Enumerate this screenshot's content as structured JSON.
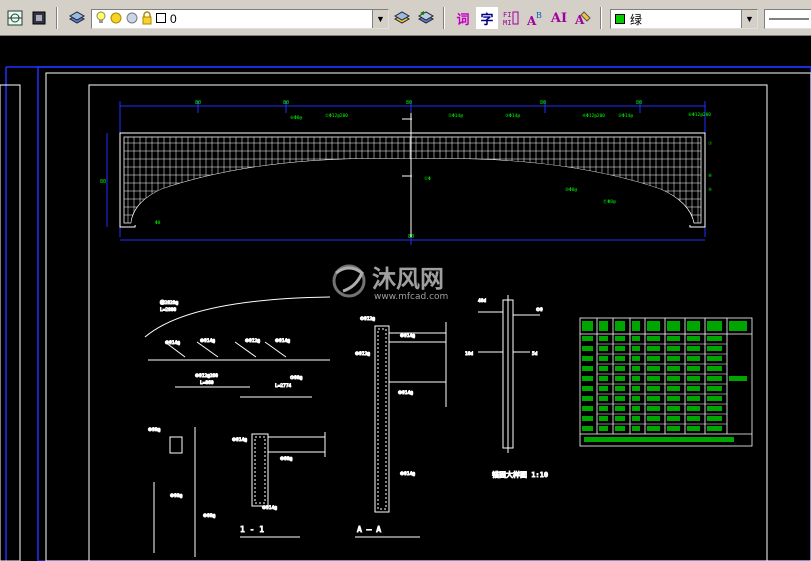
{
  "toolbar": {
    "layer_combo": {
      "value": "0"
    },
    "color_combo": {
      "value": "绿",
      "swatch": "#00cc00"
    },
    "text_buttons": [
      "词",
      "字",
      "AI"
    ],
    "icons": [
      "layer-manager-icon",
      "layer-states-icon",
      "lightbulb-icon",
      "sun-icon",
      "freeze-icon",
      "lock-icon",
      "color-square-icon",
      "make-current-icon",
      "layer-previous-icon",
      "text-style-icon",
      "mtext-icon",
      "field-icon",
      "spell-check-icon",
      "find-text-icon"
    ]
  },
  "drawing": {
    "watermark": {
      "brand": "沐风网",
      "url": "www.mfcad.com"
    },
    "labels": {
      "detail_title": "锚固大样图  1:10",
      "section1": "1 - 1",
      "sectionA": "A — A"
    },
    "colors": {
      "background": "#000000",
      "lines": "#ffffff",
      "text": "#00ff00",
      "border": "#0000ff",
      "dims": "#0000ff"
    }
  }
}
